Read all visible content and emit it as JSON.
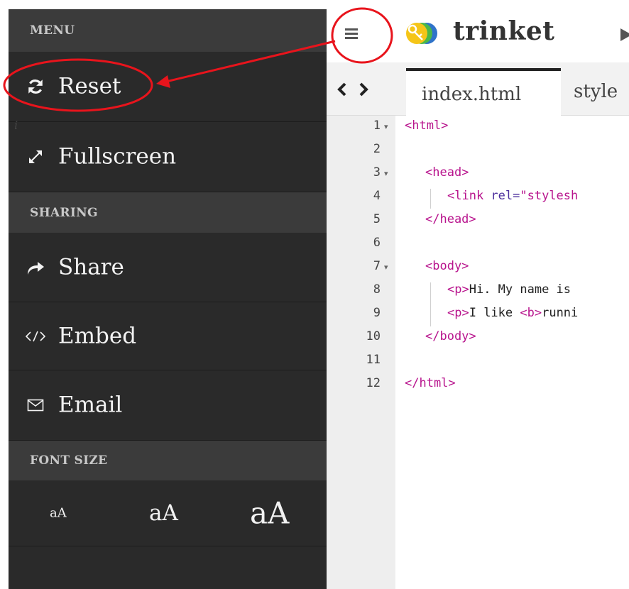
{
  "sidebar": {
    "menu_header": "MENU",
    "sharing_header": "SHARING",
    "font_size_header": "FONT SIZE",
    "items": [
      {
        "label": "Reset",
        "icon": "refresh-icon"
      },
      {
        "label": "Fullscreen",
        "icon": "expand-icon"
      },
      {
        "label": "Share",
        "icon": "share-arrow-icon"
      },
      {
        "label": "Embed",
        "icon": "code-icon"
      },
      {
        "label": "Email",
        "icon": "envelope-icon"
      }
    ],
    "font_sizes": [
      {
        "label": "aA",
        "size": "small"
      },
      {
        "label": "aA",
        "size": "medium"
      },
      {
        "label": "aA",
        "size": "large"
      }
    ]
  },
  "header": {
    "brand": "trinket",
    "menu_icon": "hamburger-icon",
    "run_icon": "play-icon"
  },
  "tabs": [
    {
      "label": "index.html",
      "active": true
    },
    {
      "label": "style",
      "active": false
    }
  ],
  "editor": {
    "info_marker": "i",
    "lines": [
      {
        "num": "1",
        "fold": true
      },
      {
        "num": "2",
        "fold": false
      },
      {
        "num": "3",
        "fold": true
      },
      {
        "num": "4",
        "fold": false
      },
      {
        "num": "5",
        "fold": false
      },
      {
        "num": "6",
        "fold": false
      },
      {
        "num": "7",
        "fold": true
      },
      {
        "num": "8",
        "fold": false
      },
      {
        "num": "9",
        "fold": false
      },
      {
        "num": "10",
        "fold": false
      },
      {
        "num": "11",
        "fold": false
      },
      {
        "num": "12",
        "fold": false
      }
    ],
    "code": {
      "l1": "<html>",
      "l3": "<head>",
      "l4_tag_open": "<link ",
      "l4_attr": "rel=",
      "l4_value": "\"stylesh",
      "l5": "</head>",
      "l7": "<body>",
      "l8_tag": "<p>",
      "l8_text": "Hi. My name is",
      "l9_tag": "<p>",
      "l9_text": "I like ",
      "l9_tag_b": "<b>",
      "l9_text_2": "runni",
      "l10": "</body>",
      "l12": "</html>"
    }
  },
  "colors": {
    "sidebar_bg": "#2a2a2a",
    "section_header_bg": "#3b3b3b",
    "annotation_red": "#e8141c",
    "tag_magenta": "#b8148d",
    "attr_purple": "#4b2e9c"
  }
}
